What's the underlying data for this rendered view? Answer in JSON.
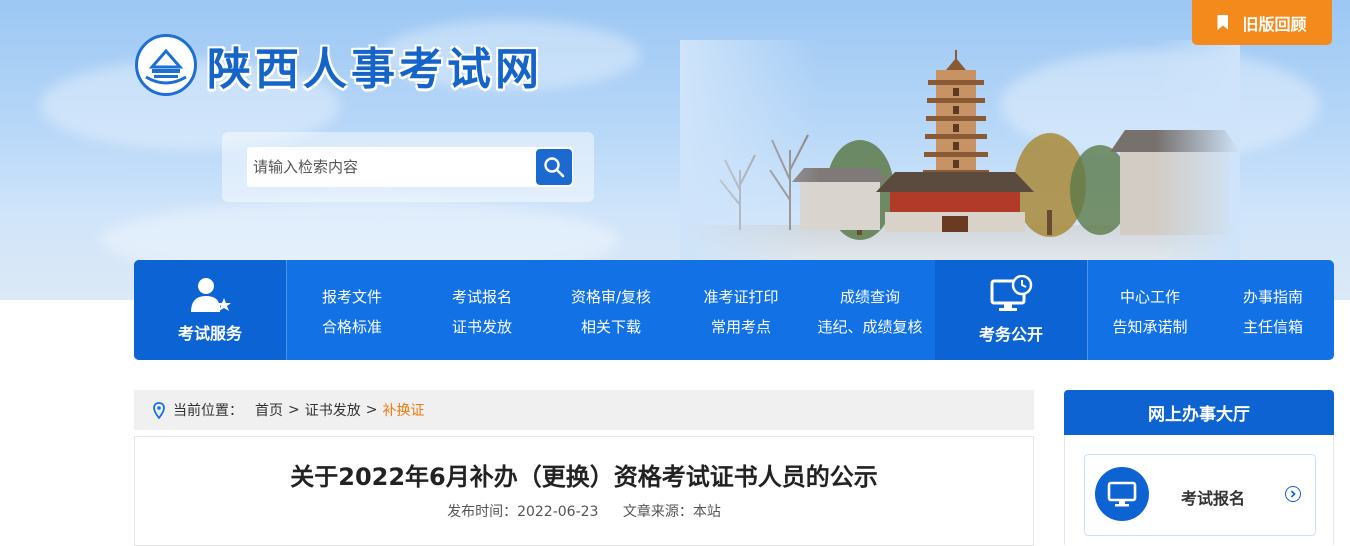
{
  "header": {
    "site_title": "陕西人事考试网",
    "old_version_label": "旧版回顾",
    "search": {
      "placeholder": "请输入检索内容"
    }
  },
  "nav": {
    "service_block": {
      "label": "考试服务",
      "icon": "user-star-icon"
    },
    "service_links": [
      [
        "报考文件",
        "合格标准"
      ],
      [
        "考试报名",
        "证书发放"
      ],
      [
        "资格审/复核",
        "相关下载"
      ],
      [
        "准考证打印",
        "常用考点"
      ],
      [
        "成绩查询",
        "违纪、成绩复核"
      ]
    ],
    "public_block": {
      "label": "考务公开",
      "icon": "monitor-clock-icon"
    },
    "public_links": [
      [
        "中心工作",
        "告知承诺制"
      ],
      [
        "办事指南",
        "主任信箱"
      ]
    ]
  },
  "breadcrumb": {
    "prefix": "当前位置：",
    "items": [
      "首页",
      "证书发放"
    ],
    "current": "补换证",
    "separator": ">"
  },
  "article": {
    "title": "关于2022年6月补办（更换）资格考试证书人员的公示",
    "publish_label": "发布时间：",
    "publish_date": "2022-06-23",
    "source_label": "文章来源：",
    "source": "本站"
  },
  "sidebar": {
    "title": "网上办事大厅",
    "cards": [
      {
        "label": "考试报名",
        "icon": "monitor-icon"
      }
    ]
  },
  "colors": {
    "primary": "#1272e5",
    "primary_dark": "#0c63d4",
    "accent_orange": "#f48a1c",
    "breadcrumb_current": "#f07a10"
  }
}
